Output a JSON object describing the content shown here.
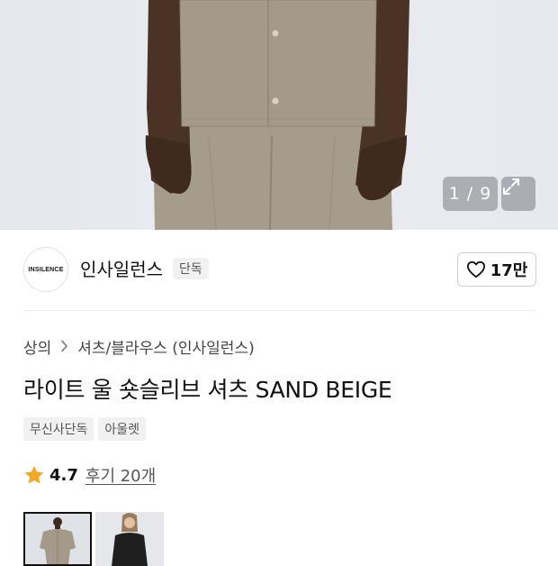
{
  "gallery": {
    "counter": "1 / 9",
    "expand_icon": "expand-icon"
  },
  "brand": {
    "logo_text": "INSILENCE",
    "name": "인사일런스",
    "badge": "단독",
    "like_icon": "heart-outline-icon",
    "like_count": "17만"
  },
  "breadcrumb": {
    "items": [
      "상의",
      "셔츠/블라우스 (인사일런스)"
    ],
    "separator_icon": "chevron-right-icon"
  },
  "product": {
    "title": "라이트 울 숏슬리브 셔츠 SAND BEIGE",
    "tags": [
      "무신사단독",
      "아울렛"
    ]
  },
  "rating": {
    "star_icon": "star-filled-icon",
    "score": "4.7",
    "review_link": "후기 20개"
  },
  "colors": {
    "star": "#f5a623",
    "garment": "#a59a89"
  }
}
